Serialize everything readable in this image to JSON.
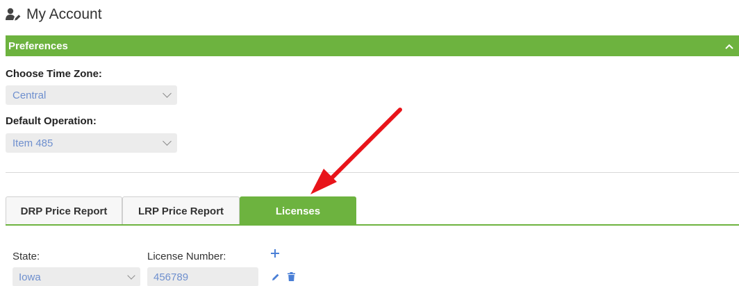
{
  "header": {
    "title": "My Account",
    "icon": "user-edit-icon"
  },
  "preferences": {
    "title": "Preferences",
    "collapse_icon": "chevron-up-icon",
    "time_zone": {
      "label": "Choose Time Zone:",
      "value": "Central"
    },
    "default_operation": {
      "label": "Default Operation:",
      "value": "Item 485"
    }
  },
  "tabs": [
    {
      "label": "DRP Price Report",
      "active": false
    },
    {
      "label": "LRP Price Report",
      "active": false
    },
    {
      "label": "Licenses",
      "active": true
    }
  ],
  "licenses": {
    "state_label": "State:",
    "license_label": "License Number:",
    "add_icon": "plus-icon",
    "rows": [
      {
        "state": "Iowa",
        "license_number": "456789",
        "edit_icon": "pencil-icon",
        "delete_icon": "trash-icon"
      }
    ]
  },
  "colors": {
    "accent": "#6db33f",
    "link": "#4a7fd6",
    "annotation": "#e8141a"
  }
}
